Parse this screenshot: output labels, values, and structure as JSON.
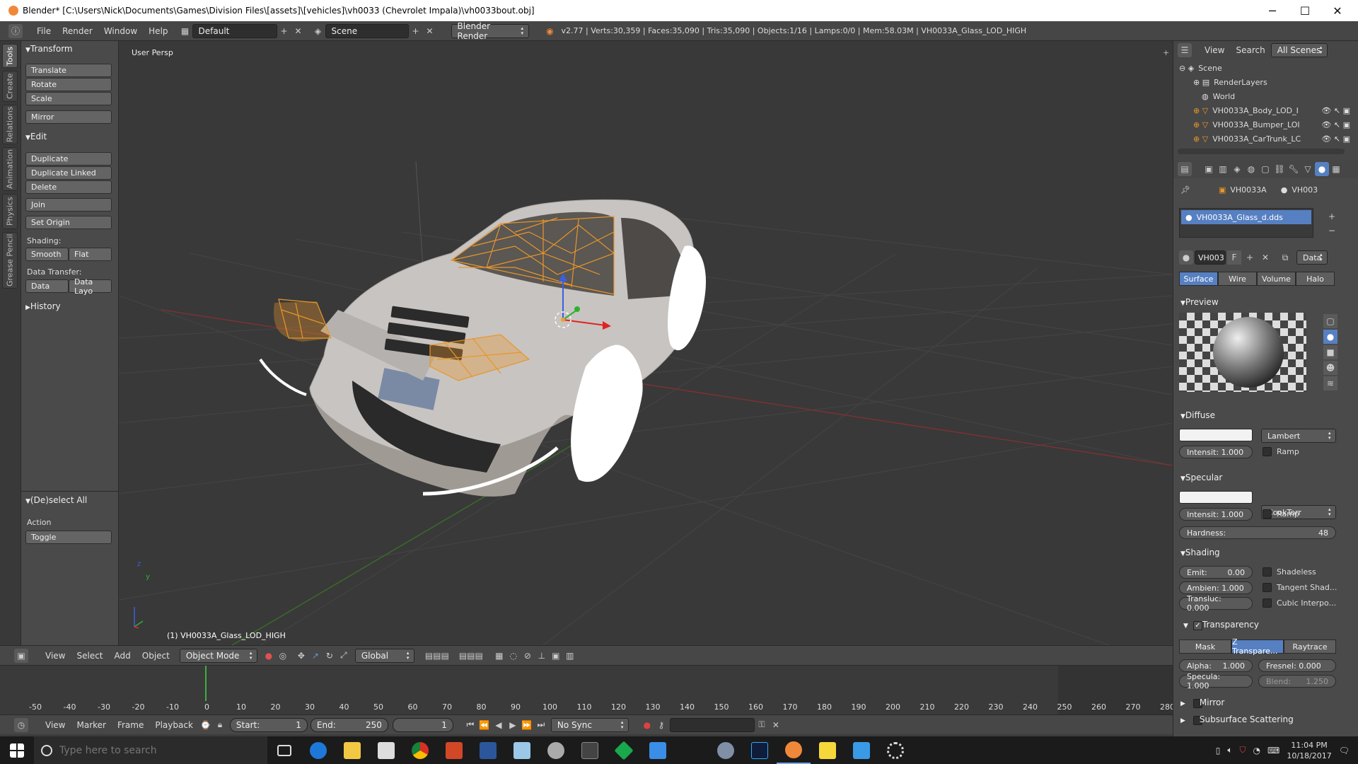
{
  "window": {
    "title": "Blender* [C:\\Users\\Nick\\Documents\\Games\\Division Files\\[assets]\\[vehicles]\\vh0033  (Chevrolet Impala)\\vh0033bout.obj]",
    "minimize": "─",
    "maximize": "☐",
    "close": "✕"
  },
  "infobar": {
    "menus": [
      "File",
      "Render",
      "Window",
      "Help"
    ],
    "layout": "Default",
    "scene": "Scene",
    "engine": "Blender Render",
    "stats": "v2.77 | Verts:30,359 | Faces:35,090 | Tris:35,090 | Objects:1/16 | Lamps:0/0 | Mem:58.03M | VH0033A_Glass_LOD_HIGH"
  },
  "vtabs": [
    "Tools",
    "Create",
    "Relations",
    "Animation",
    "Physics",
    "Grease Pencil"
  ],
  "toolshelf": {
    "transform_header": "Transform",
    "translate": "Translate",
    "rotate": "Rotate",
    "scale": "Scale",
    "mirror": "Mirror",
    "edit_header": "Edit",
    "duplicate": "Duplicate",
    "duplicate_linked": "Duplicate Linked",
    "delete": "Delete",
    "join": "Join",
    "set_origin": "Set Origin",
    "shading_label": "Shading:",
    "smooth": "Smooth",
    "flat": "Flat",
    "data_transfer_label": "Data Transfer:",
    "data": "Data",
    "data_layout": "Data Layo",
    "history_header": "History",
    "operator_header": "(De)select All",
    "action_label": "Action",
    "action_value": "Toggle"
  },
  "viewport": {
    "view_name": "User Persp",
    "object_label": "(1) VH0033A_Glass_LOD_HIGH",
    "axis_z": "z",
    "axis_y": "y"
  },
  "viewheader": {
    "menus": [
      "View",
      "Select",
      "Add",
      "Object"
    ],
    "mode": "Object Mode",
    "orientation": "Global"
  },
  "timeline": {
    "ticks": [
      "-50",
      "-40",
      "-30",
      "-20",
      "-10",
      "0",
      "10",
      "20",
      "30",
      "40",
      "50",
      "60",
      "70",
      "80",
      "90",
      "100",
      "110",
      "120",
      "130",
      "140",
      "150",
      "160",
      "170",
      "180",
      "190",
      "200",
      "210",
      "220",
      "230",
      "240",
      "250",
      "260",
      "270",
      "280"
    ],
    "menus": [
      "View",
      "Marker",
      "Frame",
      "Playback"
    ],
    "start_label": "Start:",
    "start_value": "1",
    "end_label": "End:",
    "end_value": "250",
    "current_frame": "1",
    "sync": "No Sync"
  },
  "outliner": {
    "menus": [
      "View",
      "Search"
    ],
    "filter": "All Scenes",
    "items": [
      "Scene",
      "RenderLayers",
      "World",
      "VH0033A_Body_LOD_I",
      "VH0033A_Bumper_LOI",
      "VH0033A_CarTrunk_LC"
    ]
  },
  "properties": {
    "breadcrumb_obj": "VH0033A",
    "breadcrumb_mat": "VH003",
    "material_slot": "VH0033A_Glass_d.dds",
    "material_name": "VH003",
    "fake_user": "F",
    "link": "Data",
    "tabs": [
      "Surface",
      "Wire",
      "Volume",
      "Halo"
    ],
    "preview_header": "Preview",
    "diffuse_header": "Diffuse",
    "diffuse_shader": "Lambert",
    "diffuse_intensity": "Intensit: 1.000",
    "diffuse_ramp": "Ramp",
    "specular_header": "Specular",
    "specular_shader": "CookTorr",
    "specular_intensity": "Intensit: 1.000",
    "specular_ramp": "Ramp",
    "hardness_label": "Hardness:",
    "hardness_value": "48",
    "shading_header": "Shading",
    "emit": "Emit:",
    "emit_value": "0.00",
    "ambient": "Ambien: 1.000",
    "transluc": "Transluc: 0.000",
    "shadeless": "Shadeless",
    "tangent": "Tangent Shad...",
    "cubic": "Cubic Interpo...",
    "transparency_header": "Transparency",
    "trans_tabs": [
      "Mask",
      "Z Transpare...",
      "Raytrace"
    ],
    "alpha": "Alpha:",
    "alpha_value": "1.000",
    "fresnel": "Fresnel: 0.000",
    "specula": "Specula: 1.000",
    "blend": "Blend:",
    "blend_value": "1.250",
    "mirror_header": "Mirror",
    "sss_header": "Subsurface Scattering"
  },
  "taskbar": {
    "search_placeholder": "Type here to search",
    "time": "11:04 PM",
    "date": "10/18/2017"
  },
  "colors": {
    "selection_blue": "#5680c2",
    "wire_orange": "#e8962a",
    "car_body": "#c9c5c2"
  }
}
